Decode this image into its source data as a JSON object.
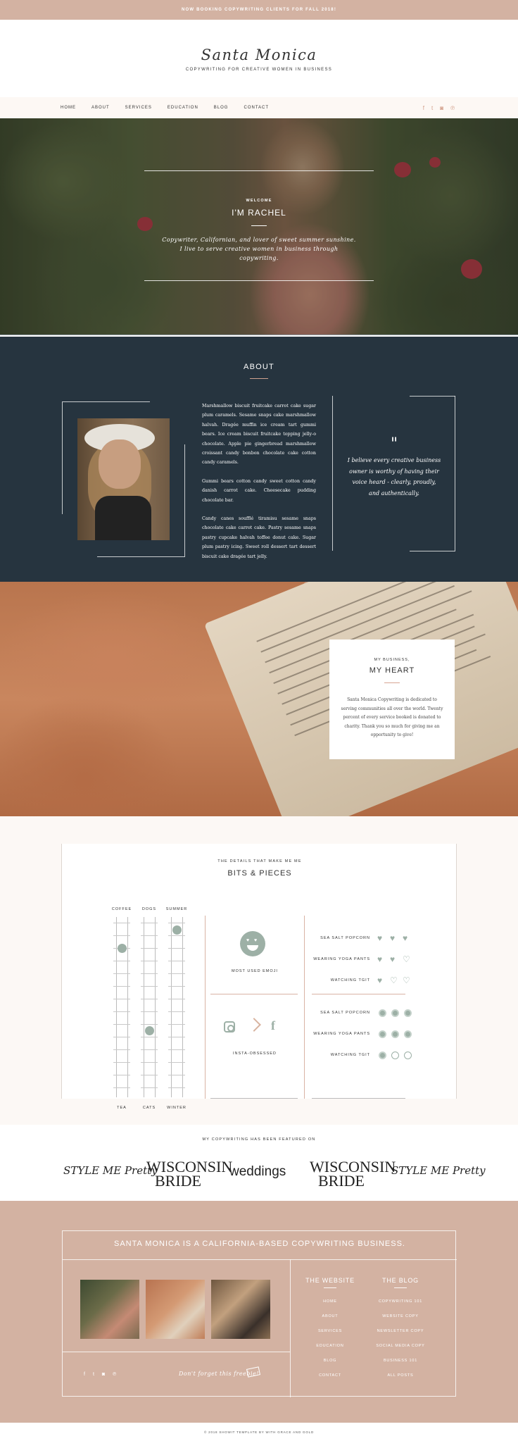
{
  "topbar": {
    "text": "NOW BOOKING COPYWRITING CLIENTS FOR FALL 2018!"
  },
  "header": {
    "logo": "Santa Monica",
    "tagline": "COPYWRITING FOR CREATIVE WOMEN IN BUSINESS"
  },
  "nav": {
    "items": [
      "HOME",
      "ABOUT",
      "SERVICES",
      "EDUCATION",
      "BLOG",
      "CONTACT"
    ],
    "social_icons": [
      "facebook-icon",
      "twitter-icon",
      "instagram-icon",
      "pinterest-icon"
    ],
    "social_glyphs": [
      "f",
      "t",
      "◙",
      "℗"
    ]
  },
  "hero": {
    "kicker": "WELCOME",
    "title": "I'M RACHEL",
    "subtitle": "Copywriter, Californian, and lover of sweet summer sunshine. I live to serve creative women in business through copywriting."
  },
  "about": {
    "title": "ABOUT",
    "paragraphs": [
      "Marshmallow biscuit fruitcake carrot cake sugar plum caramels. Sesame snaps cake marshmallow halvah. Dragée muffin ice cream tart gummi bears. Ice cream biscuit fruitcake topping jelly-o chocolate. Apple pie gingerbread marshmallow croissant candy bonbon chocolate cake cotton candy caramels.",
      "Gummi bears cotton candy sweet cotton candy danish carrot cake. Cheesecake pudding chocolate bar.",
      "Candy canes soufflé tiramisu sesame snaps chocolate cake carrot cake. Pastry sesame snaps pastry cupcake halvah toffee donut cake. Sugar plum pastry icing. Sweet roll dessert tart dessert biscuit cake dragée tart jelly."
    ],
    "quote_mark": "\"",
    "quote": "I believe every creative business owner is worthy of having their voice heard - clearly, proudly, and authentically."
  },
  "heart": {
    "kicker": "MY BUSINESS,",
    "title": "MY HEART",
    "text": "Santa Monica Copywriting is dedicated to serving communities all over the world. Twenty percent of every service booked is donated to charity. Thank you so much for giving me an opportunity to give!"
  },
  "bits": {
    "kicker": "THE DETAILS THAT MAKE ME ME",
    "title": "BITS & PIECES",
    "top_labels": [
      "COFFEE",
      "DOGS",
      "SUMMER"
    ],
    "bottom_labels": [
      "TEA",
      "CATS",
      "WINTER"
    ],
    "slider_positions": [
      0.17,
      0.63,
      0.07
    ],
    "emoji_label": "MOST USED EMOJI",
    "insta_label": "INSTA-OBSESSED",
    "hearts": [
      {
        "label": "SEA SALT POPCORN",
        "filled": 3
      },
      {
        "label": "WEARING YOGA PANTS",
        "filled": 2
      },
      {
        "label": "WATCHING TGIT",
        "filled": 1
      }
    ],
    "circles": [
      {
        "label": "SEA SALT POPCORN",
        "filled": 3
      },
      {
        "label": "WEARING YOGA PANTS",
        "filled": 3
      },
      {
        "label": "WATCHING TGIT",
        "filled": 1
      }
    ],
    "accent": "#9db0a6"
  },
  "featured": {
    "kicker": "MY COPYWRITING HAS BEEN FEATURED ON",
    "logos": [
      "STYLE ME Pretty",
      "WISCONSIN BRIDE",
      "weddings",
      "WISCONSIN BRIDE",
      "STYLE ME Pretty"
    ]
  },
  "footer": {
    "headline": "SANTA MONICA IS A CALIFORNIA-BASED COPYWRITING BUSINESS.",
    "website_title": "THE WEBSITE",
    "website_links": [
      "HOME",
      "ABOUT",
      "SERVICES",
      "EDUCATION",
      "BLOG",
      "CONTACT"
    ],
    "blog_title": "THE BLOG",
    "blog_links": [
      "COPYWRITING 101",
      "WEBSITE COPY",
      "NEWSLETTER COPY",
      "SOCIAL MEDIA COPY",
      "BUSINESS 101",
      "ALL POSTS"
    ],
    "social_icons": [
      "facebook-icon",
      "twitter-icon",
      "instagram-icon",
      "pinterest-icon"
    ],
    "social_glyphs": [
      "f",
      "t",
      "◙",
      "℗"
    ],
    "freebie": "Don't forget this freebie!",
    "background": "#d3b2a2"
  },
  "copyright": "© 2018 SHOWIT TEMPLATE BY WITH GRACE AND GOLD"
}
